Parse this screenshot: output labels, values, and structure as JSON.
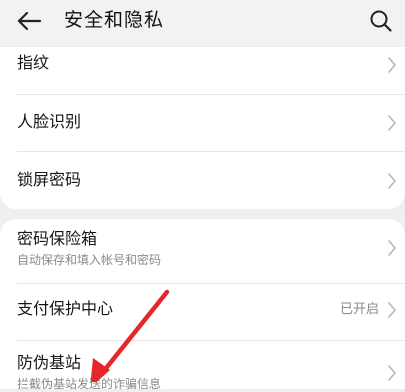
{
  "header": {
    "title": "安全和隐私",
    "back_icon": "arrow-left-icon",
    "search_icon": "search-icon"
  },
  "group1": [
    {
      "label": "指纹"
    },
    {
      "label": "人脸识别"
    },
    {
      "label": "锁屏密码"
    }
  ],
  "group2": [
    {
      "label": "密码保险箱",
      "subtitle": "自动保存和填入帐号和密码"
    },
    {
      "label": "支付保护中心",
      "status": "已开启"
    },
    {
      "label": "防伪基站",
      "subtitle": "拦截伪基站发送的诈骗信息"
    }
  ],
  "annotation": {
    "color": "#e5262b"
  },
  "colors": {
    "background": "#efefef",
    "card": "#ffffff",
    "secondary_text": "#8a8a8a"
  }
}
